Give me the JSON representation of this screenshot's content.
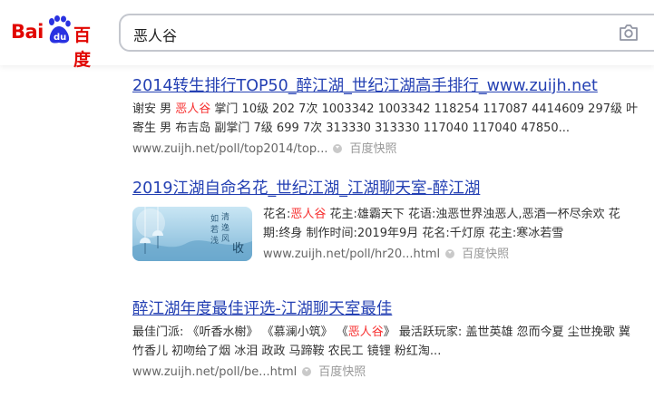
{
  "logo": {
    "bai": "Bai",
    "du": "du",
    "cn": "百度"
  },
  "search": {
    "query": "恶人谷"
  },
  "results": [
    {
      "title": "2014转生排行TOP50_醉江湖_世纪江湖高手排行_www.zuijh.net",
      "abs_pre": "谢安 男 ",
      "abs_em": "恶人谷",
      "abs_post": " 掌门 10级 202 7次 1003342 1003342 118254 117087 4414609 297级 叶寄生 男 布吉岛 副掌门 7级 699 7次 313330 313330 117040 117040 47850...",
      "url": "www.zuijh.net/poll/top2014/top...",
      "snapshot": "百度快照"
    },
    {
      "title": "2019江湖自命名花_世纪江湖_江湖聊天室-醉江湖",
      "abs_pre": "花名:",
      "abs_em": "恶人谷",
      "abs_post": " 花主:雄霸天下 花语:浊恶世界浊恶人,恶酒一杯尽余欢 花期:终身 制作时间:2019年9月 花名:千灯原 花主:寒冰若雪",
      "url": "www.zuijh.net/poll/hr20...html",
      "snapshot": "百度快照"
    },
    {
      "title": "醉江湖年度最佳评选-江湖聊天室最佳",
      "abs_pre": "最佳门派: 《听香水榭》 《慕澜小筑》 《",
      "abs_em": "恶人谷",
      "abs_post": "》 最活跃玩家: 盖世英雄 忽而今夏 尘世挽歌 冀竹香儿 初吻给了烟 冰泪 政政 马蹄鞍 农民工 镜锂 粉红淘...",
      "url": "www.zuijh.net/poll/be...html",
      "snapshot": "百度快照"
    }
  ],
  "thumb_text": [
    "如",
    "若",
    "清",
    "逸",
    "浅",
    "风",
    "收"
  ],
  "colors": {
    "brand": "#e10601",
    "link": "#2440b3",
    "highlight": "#f73131"
  }
}
